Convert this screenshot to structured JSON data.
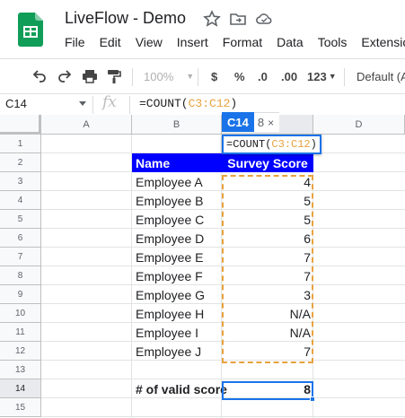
{
  "app": {
    "title": "LiveFlow - Demo",
    "menu": [
      "File",
      "Edit",
      "View",
      "Insert",
      "Format",
      "Data",
      "Tools",
      "Extensio"
    ]
  },
  "toolbar": {
    "zoom": "100%",
    "currency": "$",
    "percent": "%",
    "decrease_decimal": ".0",
    "increase_decimal": ".00",
    "more_formats": "123",
    "font": "Default (A"
  },
  "formula_bar": {
    "cell_ref": "C14",
    "fx": "fx",
    "formula_prefix": "=COUNT(",
    "formula_range": "C3:C12",
    "formula_suffix": ")"
  },
  "cell_editor": {
    "ref": "C14",
    "value": "8",
    "close": "×"
  },
  "grid": {
    "columns": [
      "A",
      "B",
      "C",
      "D"
    ],
    "rows": [
      "1",
      "2",
      "3",
      "4",
      "5",
      "6",
      "7",
      "8",
      "9",
      "10",
      "11",
      "12",
      "13",
      "14",
      "15"
    ],
    "header": {
      "name": "Name",
      "score": "Survey Score"
    },
    "employees": [
      {
        "name": "Employee A",
        "score": "4"
      },
      {
        "name": "Employee B",
        "score": "5"
      },
      {
        "name": "Employee C",
        "score": "5"
      },
      {
        "name": "Employee D",
        "score": "6"
      },
      {
        "name": "Employee E",
        "score": "7"
      },
      {
        "name": "Employee F",
        "score": "7"
      },
      {
        "name": "Employee G",
        "score": "3"
      },
      {
        "name": "Employee H",
        "score": "N/A"
      },
      {
        "name": "Employee I",
        "score": "N/A"
      },
      {
        "name": "Employee J",
        "score": "7"
      }
    ],
    "summary": {
      "label": "# of valid score",
      "value": "8"
    }
  },
  "colors": {
    "header_fill": "#0000ff",
    "range_highlight": "#e8a23d",
    "selection": "#1a73e8",
    "sheets_green": "#0f9d58"
  }
}
